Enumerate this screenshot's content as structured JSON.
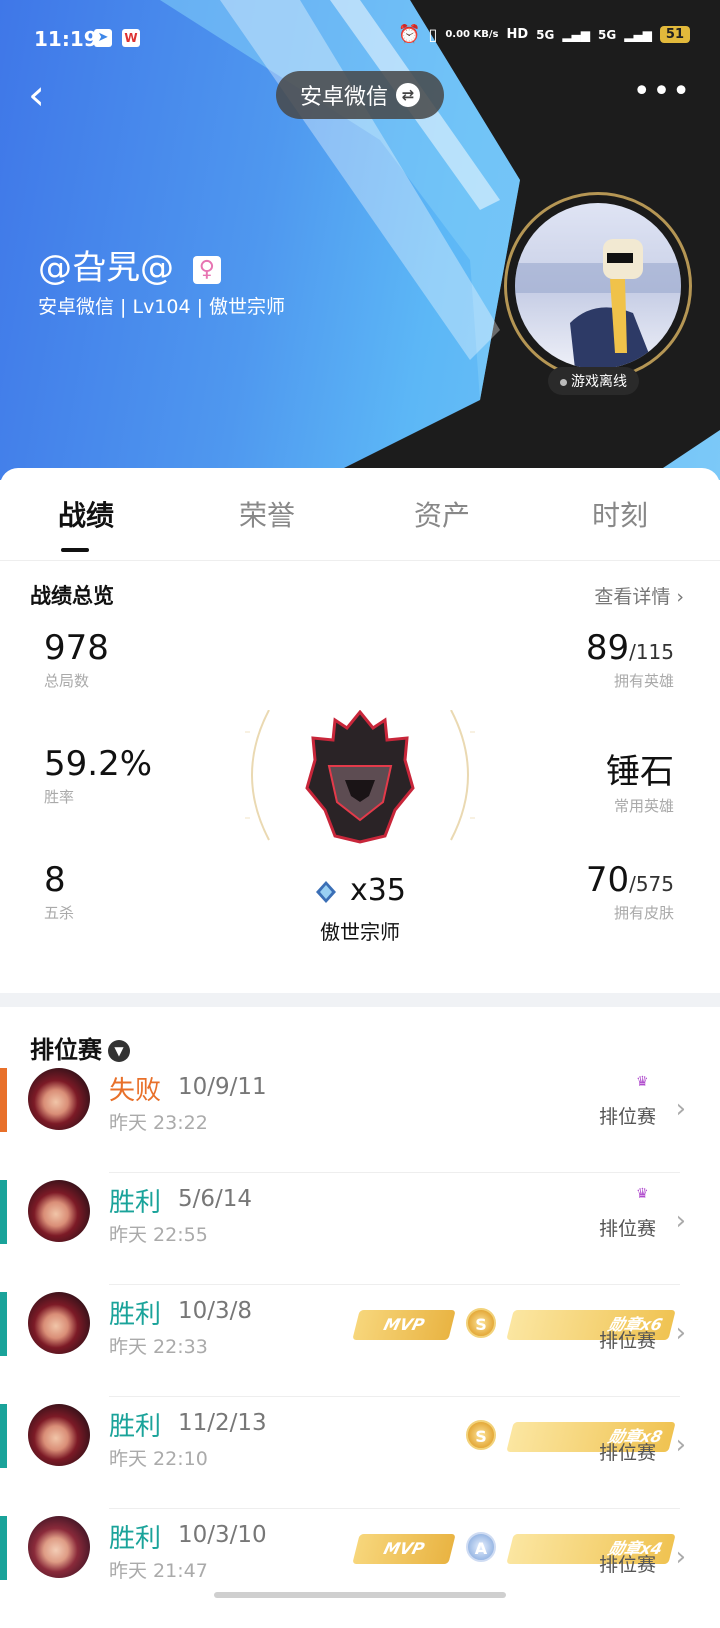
{
  "status_bar": {
    "time": "11:19",
    "net_speed": "0.00 KB/s",
    "network1": "5G",
    "network2": "5G",
    "battery": "51"
  },
  "header": {
    "account_switch": "安卓微信",
    "nickname": "@旮旯@",
    "subinfo": "安卓微信 | Lv104 | 傲世宗师",
    "offline_label": "游戏离线"
  },
  "tabs": [
    {
      "label": "战绩",
      "active": true
    },
    {
      "label": "荣誉",
      "active": false
    },
    {
      "label": "资产",
      "active": false
    },
    {
      "label": "时刻",
      "active": false
    }
  ],
  "overview": {
    "title": "战绩总览",
    "detail_link": "查看详情",
    "total_games": {
      "value": "978",
      "label": "总局数"
    },
    "win_rate": {
      "value": "59.2%",
      "label": "胜率"
    },
    "penta": {
      "value": "8",
      "label": "五杀"
    },
    "heroes": {
      "value": "89",
      "total": "/115",
      "label": "拥有英雄"
    },
    "common_hero": {
      "value": "锤石",
      "label": "常用英雄"
    },
    "skins": {
      "value": "70",
      "total": "/575",
      "label": "拥有皮肤"
    },
    "rank_stars": "x35",
    "rank_name": "傲世宗师"
  },
  "match_list": {
    "title": "排位赛",
    "matches": [
      {
        "result": "失败",
        "kda": "10/9/11",
        "time": "昨天 23:22",
        "mode": "排位赛"
      },
      {
        "result": "胜利",
        "kda": "5/6/14",
        "time": "昨天 22:55",
        "mode": "排位赛"
      },
      {
        "result": "胜利",
        "kda": "10/3/8",
        "time": "昨天 22:33",
        "mode": "排位赛",
        "mvp": "MVP",
        "grade": "S",
        "medal": "勋章x6"
      },
      {
        "result": "胜利",
        "kda": "11/2/13",
        "time": "昨天 22:10",
        "mode": "排位赛",
        "grade": "S",
        "medal": "勋章x8"
      },
      {
        "result": "胜利",
        "kda": "10/3/10",
        "time": "昨天 21:47",
        "mode": "排位赛",
        "mvp": "MVP",
        "grade": "A",
        "medal": "勋章x4"
      }
    ]
  },
  "colors": {
    "lose": "#e8702a",
    "win": "#1aa39a",
    "header_blue": "#4f98ef"
  }
}
